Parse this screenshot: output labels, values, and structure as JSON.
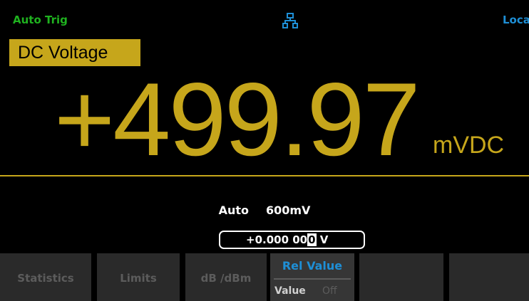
{
  "status": {
    "trigger": "Auto Trig",
    "network_icon": "network-icon",
    "mode": "Local"
  },
  "function": "DC Voltage",
  "reading": {
    "value": "+499.97",
    "unit": "mVDC"
  },
  "range": {
    "mode": "Auto",
    "value": "600mV"
  },
  "rel_input": {
    "value_prefix": "+0.000 00",
    "cursor_digit": "0",
    "unit": "V"
  },
  "softkeys": {
    "statistics": "Statistics",
    "limits": "Limits",
    "db_dbm": "dB /dBm",
    "rel_title": "Rel Value",
    "rel_value": "Value",
    "rel_off": "Off"
  },
  "colors": {
    "accent": "#c6a61b",
    "trigger": "#1fb21f",
    "info": "#1e8fd6"
  }
}
